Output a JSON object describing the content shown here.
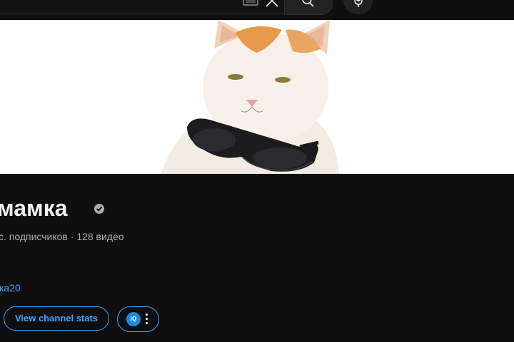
{
  "channel": {
    "name": "мамка",
    "meta": "с. подписчиков · 128 видео",
    "link": "ка20"
  },
  "actions": {
    "stats_label": "View channel stats",
    "extension_logo": "iQ"
  },
  "icons": [
    "keyboard-icon",
    "clear-icon",
    "search-icon",
    "mic-icon",
    "verified-icon",
    "more-vert-icon"
  ],
  "colors": {
    "background": "#0f0f0f",
    "text": "#f1f1f1",
    "secondary_text": "#aaaaaa",
    "accent": "#3ea6ff"
  }
}
